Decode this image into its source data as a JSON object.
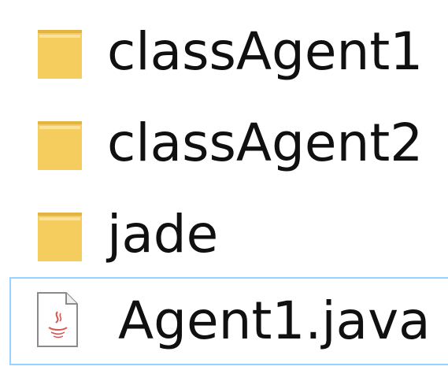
{
  "items": [
    {
      "name": "classAgent1",
      "icon": "folder-icon"
    },
    {
      "name": "classAgent2",
      "icon": "folder-icon"
    },
    {
      "name": "jade",
      "icon": "folder-icon"
    },
    {
      "name": "Agent1.java",
      "icon": "java-file-icon",
      "selected": true
    }
  ],
  "colors": {
    "folder": "#f5cd5e",
    "folder_dark": "#e3b343",
    "selection_border": "#99d1ff"
  }
}
